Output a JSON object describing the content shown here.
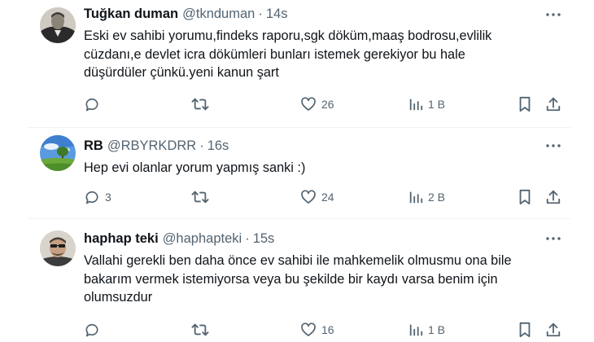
{
  "tweets": [
    {
      "name": "Tuğkan duman",
      "handle": "@tknduman",
      "separator": "·",
      "time": "14s",
      "lines": [
        "Eski ev sahibi yorumu,findeks raporu,sgk döküm,maaş bodrosu,evlilik",
        "cüzdanı,e devlet icra dökümleri bunları istemek gerekiyor bu hale",
        "düşürdüler çünkü.yeni kanun şart"
      ],
      "replies": "",
      "reposts": "",
      "likes": "26",
      "views": "1 B"
    },
    {
      "name": "RB",
      "handle": "@RBYRKDRR",
      "separator": "·",
      "time": "16s",
      "lines": [
        "Hep evi olanlar yorum yapmış sanki :)"
      ],
      "replies": "3",
      "reposts": "",
      "likes": "24",
      "views": "2 B"
    },
    {
      "name": "haphap teki",
      "handle": "@haphapteki",
      "separator": "·",
      "time": "15s",
      "lines": [
        "Vallahi gerekli ben daha önce ev sahibi ile mahkemelik olmusmu ona bile",
        "bakarım vermek istemiyorsa veya bu şekilde bir kaydı varsa benim için",
        "olumsuzdur"
      ],
      "replies": "",
      "reposts": "",
      "likes": "16",
      "views": "1 B"
    }
  ],
  "icons": {
    "reply": "reply-icon",
    "repost": "repost-icon",
    "like": "heart-icon",
    "views": "views-icon",
    "bookmark": "bookmark-icon",
    "share": "share-icon",
    "more": "more-icon"
  },
  "colors": {
    "text": "#0f1419",
    "secondary": "#536471",
    "divider": "#eff3f4"
  }
}
